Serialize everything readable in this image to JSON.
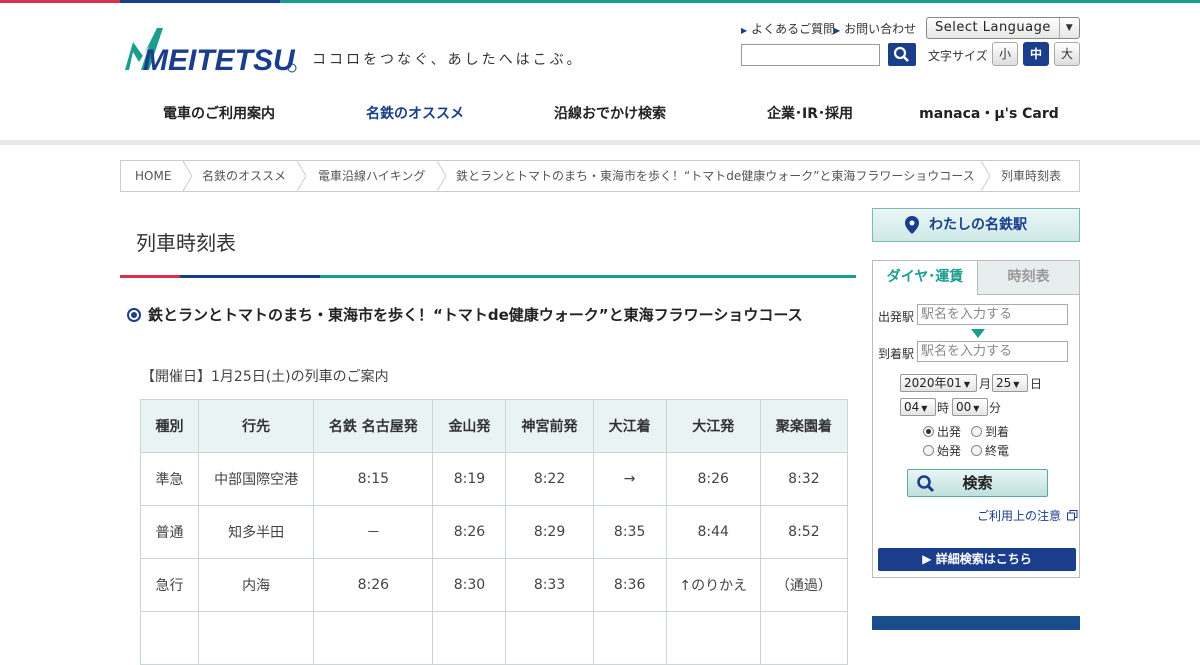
{
  "header": {
    "logo_text": "MEITETSU",
    "tagline": "ココロをつなぐ、あしたへはこぶ。",
    "faq_link": "よくあるご質問",
    "contact_link": "お問い合わせ",
    "language_select": "Select Language",
    "search_placeholder": "",
    "font_size_label": "文字サイズ",
    "font_sizes": [
      "小",
      "中",
      "大"
    ]
  },
  "nav": {
    "items": [
      "電車のご利用案内",
      "名鉄のオススメ",
      "沿線おでかけ検索",
      "企業･IR･採用",
      "manaca・μ's Card"
    ],
    "active_index": 1
  },
  "breadcrumb": [
    "HOME",
    "名鉄のオススメ",
    "電車沿線ハイキング",
    "鉄とランとトマトのまち・東海市を歩く！“トマトde健康ウォーク”と東海フラワーショウコース",
    "列車時刻表"
  ],
  "main": {
    "page_title": "列車時刻表",
    "course_title": "鉄とランとトマトのまち・東海市を歩く！“トマトde健康ウォーク”と東海フラワーショウコース",
    "event_date": "【開催日】1月25日(土)の列車のご案内",
    "table": {
      "headers": [
        "種別",
        "行先",
        "名鉄 名古屋発",
        "金山発",
        "神宮前発",
        "大江着",
        "大江発",
        "聚楽園着"
      ],
      "rows": [
        [
          "準急",
          "中部国際空港",
          "8:15",
          "8:19",
          "8:22",
          "→",
          "8:26",
          "8:32"
        ],
        [
          "普通",
          "知多半田",
          "－",
          "8:26",
          "8:29",
          "8:35",
          "8:44",
          "8:52"
        ],
        [
          "急行",
          "内海",
          "8:26",
          "8:30",
          "8:33",
          "8:36",
          "↑のりかえ",
          "（通過）"
        ]
      ]
    }
  },
  "sidebar": {
    "my_meitetsu": "わたしの名鉄駅",
    "tabs": [
      "ダイヤ･運賃",
      "時刻表"
    ],
    "departure_label": "出発駅",
    "departure_placeholder": "駅名を入力する",
    "arrival_label": "到着駅",
    "arrival_placeholder": "駅名を入力する",
    "year_month": "2020年01",
    "month_unit": "月",
    "day": "25",
    "day_unit": "日",
    "hour": "04",
    "hour_unit": "時",
    "minute": "00",
    "minute_unit": "分",
    "radio_options": [
      "出発",
      "到着",
      "始発",
      "終電"
    ],
    "radio_selected": "出発",
    "search_button": "検索",
    "usage_notice": "ご利用上の注意",
    "detail_search": "詳細検索はこちら"
  },
  "colors": {
    "brand_blue": "#1a3e8c",
    "teal": "#1a9e8f",
    "red": "#d9304f"
  }
}
